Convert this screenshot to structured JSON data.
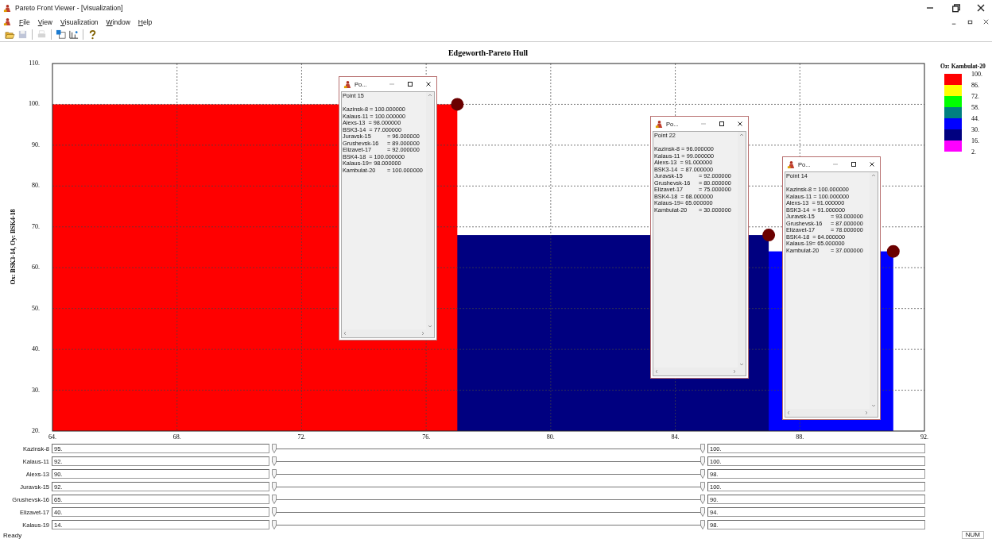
{
  "window": {
    "title": "Pareto Front Viewer - [Visualization]"
  },
  "menu": [
    "File",
    "View",
    "Visualization",
    "Window",
    "Help"
  ],
  "toolbar": [
    {
      "kind": "open",
      "disabled": false
    },
    {
      "kind": "save",
      "disabled": true
    },
    {
      "kind": "print",
      "disabled": true
    },
    {
      "kind": "window",
      "disabled": false
    },
    {
      "kind": "grid",
      "disabled": false
    },
    {
      "kind": "help",
      "disabled": false
    }
  ],
  "chart": {
    "chart_data": {
      "type": "scatter",
      "title": "Edgeworth-Pareto Hull",
      "ylabel": "Ox: BSK3-14, Oy: BSK4-18",
      "xlim": [
        64,
        92
      ],
      "ylim": [
        20,
        110
      ],
      "xticks": [
        {
          "value": 64,
          "label": "64."
        },
        {
          "value": 68,
          "label": "68."
        },
        {
          "value": 72,
          "label": "72."
        },
        {
          "value": 76,
          "label": "76."
        },
        {
          "value": 80,
          "label": "80."
        },
        {
          "value": 84,
          "label": "84."
        },
        {
          "value": 88,
          "label": "88."
        },
        {
          "value": 92,
          "label": "92."
        }
      ],
      "yticks": [
        {
          "value": 110,
          "label": "110."
        },
        {
          "value": 100,
          "label": "100."
        },
        {
          "value": 90,
          "label": "90."
        },
        {
          "value": 80,
          "label": "80."
        },
        {
          "value": 70,
          "label": "70."
        },
        {
          "value": 60,
          "label": "60."
        },
        {
          "value": 50,
          "label": "50."
        },
        {
          "value": 40,
          "label": "40."
        },
        {
          "value": 30,
          "label": "30."
        },
        {
          "value": 20,
          "label": "20."
        }
      ],
      "x": [
        77,
        87,
        91
      ],
      "grid": true,
      "series": [
        {
          "color": "#6b0000",
          "values": [
            100,
            68,
            64
          ]
        }
      ]
    },
    "hull": [
      {
        "color": "#ff0000"
      },
      {
        "color": "#000080"
      },
      {
        "color": "#0000ff"
      }
    ],
    "legend": {
      "title": "Oz: Kambulat-20",
      "items": [
        {
          "color": "#ff0000"
        },
        {
          "color": "#ffff00"
        },
        {
          "color": "#00ff00"
        },
        {
          "color": "#008080"
        },
        {
          "color": "#0000ff"
        },
        {
          "color": "#000080"
        },
        {
          "color": "#ff00ff"
        }
      ],
      "labels": [
        "100.",
        "86.",
        "72.",
        "58.",
        "44.",
        "30.",
        "16.",
        "2."
      ]
    }
  },
  "popups": [
    {
      "title": "Po...",
      "heading": "Point 15",
      "lines": [
        {
          "kind": "text",
          "text": "Kazinsk-8 = 100.000000"
        },
        {
          "kind": "text",
          "text": "Kalaus-11 = 100.000000"
        },
        {
          "kind": "text",
          "text": "Alexs-13  = 98.000000"
        },
        {
          "kind": "text",
          "text": "BSK3-14  = 77.000000"
        },
        {
          "kind": "tab",
          "name": "Juravsk-15",
          "value": "= 96.000000"
        },
        {
          "kind": "tab",
          "name": "Grushevsk-16",
          "value": "= 89.000000"
        },
        {
          "kind": "tab",
          "name": "Elizavet-17",
          "value": "= 92.000000"
        },
        {
          "kind": "text",
          "text": "BSK4-18  = 100.000000"
        },
        {
          "kind": "text",
          "text": "Kalaus-19= 98.000000"
        },
        {
          "kind": "tab",
          "name": "Kambulat-20",
          "value": "= 100.000000"
        }
      ]
    },
    {
      "title": "Po...",
      "heading": "Point 22",
      "lines": [
        {
          "kind": "text",
          "text": "Kazinsk-8 = 96.000000"
        },
        {
          "kind": "text",
          "text": "Kalaus-11 = 99.000000"
        },
        {
          "kind": "text",
          "text": "Alexs-13  = 91.000000"
        },
        {
          "kind": "text",
          "text": "BSK3-14  = 87.000000"
        },
        {
          "kind": "tab",
          "name": "Juravsk-15",
          "value": "= 92.000000"
        },
        {
          "kind": "tab",
          "name": "Grushevsk-16",
          "value": "= 80.000000"
        },
        {
          "kind": "tab",
          "name": "Elizavet-17",
          "value": "= 75.000000"
        },
        {
          "kind": "text",
          "text": "BSK4-18  = 68.000000"
        },
        {
          "kind": "text",
          "text": "Kalaus-19= 65.000000"
        },
        {
          "kind": "tab",
          "name": "Kambulat-20",
          "value": "= 30.000000"
        }
      ]
    },
    {
      "title": "Po...",
      "heading": "Point 14",
      "lines": [
        {
          "kind": "text",
          "text": "Kazinsk-8 = 100.000000"
        },
        {
          "kind": "text",
          "text": "Kalaus-11 = 100.000000"
        },
        {
          "kind": "text",
          "text": "Alexs-13  = 91.000000"
        },
        {
          "kind": "text",
          "text": "BSK3-14  = 91.000000"
        },
        {
          "kind": "tab",
          "name": "Juravsk-15",
          "value": "= 93.000000"
        },
        {
          "kind": "tab",
          "name": "Grushevsk-16",
          "value": "= 87.000000"
        },
        {
          "kind": "tab",
          "name": "Elizavet-17",
          "value": "= 78.000000"
        },
        {
          "kind": "text",
          "text": "BSK4-18  = 64.000000"
        },
        {
          "kind": "text",
          "text": "Kalaus-19= 65.000000"
        },
        {
          "kind": "tab",
          "name": "Kambulat-20",
          "value": "= 37.000000"
        }
      ]
    }
  ],
  "filters": [
    {
      "name": "Kazinsk-8",
      "min": "95.",
      "max": "100.",
      "thumbs": [
        {
          "level": 0
        },
        {
          "level": 1
        }
      ]
    },
    {
      "name": "Kalaus-11",
      "min": "92.",
      "max": "100.",
      "thumbs": [
        {
          "level": 0
        },
        {
          "level": 1
        }
      ]
    },
    {
      "name": "Alexs-13",
      "min": "90.",
      "max": "98.",
      "thumbs": [
        {
          "level": 0
        },
        {
          "level": 1
        }
      ]
    },
    {
      "name": "Juravsk-15",
      "min": "92.",
      "max": "100.",
      "thumbs": [
        {
          "level": 0
        },
        {
          "level": 1
        }
      ]
    },
    {
      "name": "Grushevsk-16",
      "min": "65.",
      "max": "90.",
      "thumbs": [
        {
          "level": 0
        },
        {
          "level": 1
        }
      ]
    },
    {
      "name": "Elizavet-17",
      "min": "40.",
      "max": "94.",
      "thumbs": [
        {
          "level": 0
        },
        {
          "level": 1
        }
      ]
    },
    {
      "name": "Kalaus-19",
      "min": "14.",
      "max": "98.",
      "thumbs": [
        {
          "level": 0
        },
        {
          "level": 1
        }
      ]
    }
  ],
  "status_bar": {
    "text": "Ready",
    "indicators": [
      "NUM"
    ]
  }
}
